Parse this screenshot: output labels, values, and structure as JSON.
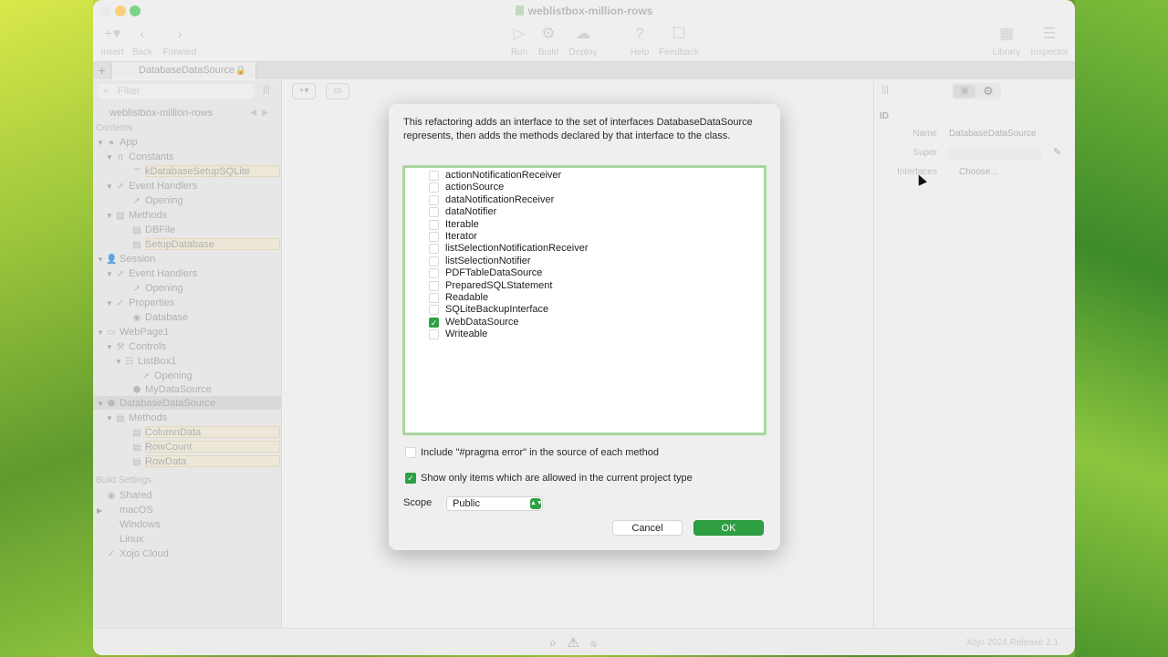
{
  "window": {
    "title": "weblistbox-million-rows"
  },
  "toolbar": {
    "insert": "Insert",
    "back": "Back",
    "forward": "Forward",
    "run": "Run",
    "build": "Build",
    "deploy": "Deploy",
    "help": "Help",
    "feedback": "Feedback",
    "library": "Library",
    "inspector": "Inspector"
  },
  "tabs": {
    "plus": "+",
    "active": "DatabaseDataSource"
  },
  "sidebar": {
    "filter_placeholder": "Filter",
    "project": "weblistbox-million-rows",
    "contents": "Contents",
    "tree": {
      "app": "App",
      "constants": "Constants",
      "k_const": "kDatabaseSetupSQLite",
      "event_handlers_1": "Event Handlers",
      "opening_1": "Opening",
      "methods_1": "Methods",
      "dbfile": "DBFile",
      "setupdb": "SetupDatabase",
      "session": "Session",
      "event_handlers_2": "Event Handlers",
      "opening_2": "Opening",
      "properties": "Properties",
      "database": "Database",
      "webpage": "WebPage1",
      "controls": "Controls",
      "listbox1": "ListBox1",
      "opening_3": "Opening",
      "mydatasource": "MyDataSource",
      "dbds": "DatabaseDataSource",
      "methods_2": "Methods",
      "columndata": "ColumnData",
      "rowcount": "RowCount",
      "rowdata": "RowData"
    },
    "build_settings": "Build Settings",
    "build": {
      "shared": "Shared",
      "macos": "macOS",
      "windows": "Windows",
      "linux": "Linux",
      "xojo_cloud": "Xojo Cloud"
    }
  },
  "inspector": {
    "section": "ID",
    "name_label": "Name",
    "name_value": "DatabaseDataSource",
    "super_label": "Super",
    "interfaces_label": "Interfaces",
    "choose": "Choose..."
  },
  "status": {
    "version": "Xojo 2024 Release 2.1"
  },
  "dialog": {
    "message": "This refactoring adds an interface to the set of interfaces DatabaseDataSource represents, then adds the methods declared by that interface to the class.",
    "interfaces": [
      {
        "name": "actionNotificationReceiver",
        "checked": false
      },
      {
        "name": "actionSource",
        "checked": false
      },
      {
        "name": "dataNotificationReceiver",
        "checked": false
      },
      {
        "name": "dataNotifier",
        "checked": false
      },
      {
        "name": "Iterable",
        "checked": false
      },
      {
        "name": "Iterator",
        "checked": false
      },
      {
        "name": "listSelectionNotificationReceiver",
        "checked": false
      },
      {
        "name": "listSelectionNotifier",
        "checked": false
      },
      {
        "name": "PDFTableDataSource",
        "checked": false
      },
      {
        "name": "PreparedSQLStatement",
        "checked": false
      },
      {
        "name": "Readable",
        "checked": false
      },
      {
        "name": "SQLiteBackupInterface",
        "checked": false
      },
      {
        "name": "WebDataSource",
        "checked": true
      },
      {
        "name": "Writeable",
        "checked": false
      }
    ],
    "include_pragma": "Include \"#pragma error\" in the source of each method",
    "include_pragma_checked": false,
    "show_only": "Show only items which are allowed in the current project type",
    "show_only_checked": true,
    "scope_label": "Scope",
    "scope_value": "Public",
    "cancel": "Cancel",
    "ok": "OK"
  },
  "colors": {
    "accent": "#2ea043",
    "focus_ring": "#a9d6a0"
  }
}
